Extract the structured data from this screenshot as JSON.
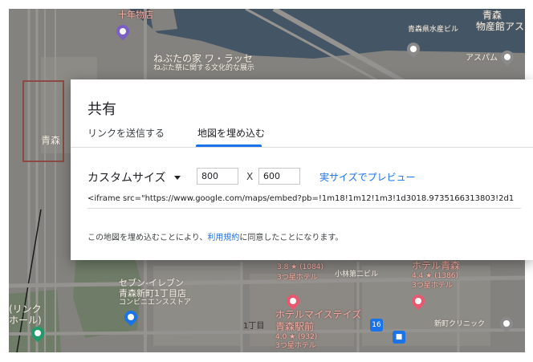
{
  "dialog": {
    "title": "共有",
    "tabs": [
      {
        "label": "リンクを送信する"
      },
      {
        "label": "地図を埋め込む"
      }
    ],
    "size_label": "カスタムサイズ",
    "width_value": "800",
    "height_value": "600",
    "x_separator": "X",
    "preview_link": "実サイズでプレビュー",
    "embed_code": "<iframe src=\"https://www.google.com/maps/embed?pb=!1m18!1m12!1m3!1d3018.9735166313803!2d1",
    "agreement_prefix": "この地図を埋め込むことにより、",
    "agreement_link": "利用規約",
    "agreement_suffix": "に同意したことになります。"
  },
  "map": {
    "labels": {
      "top_left": "十年物店",
      "nebuta_1": "ねぶたの家 ワ・ラッセ",
      "nebuta_2": "ねぶた祭に関する文化的な展示",
      "suisan": "青森県水産ビル",
      "bussan_1": "青森",
      "bussan_2": "物産館アス",
      "aspam": "アスパム",
      "aomori_sta": "青森",
      "link_1": "(リンク",
      "link_2": "ホール)",
      "seven_1": "セブン-イレブン",
      "seven_2": "青森新町1丁目店",
      "seven_3": "コンビニエンスストア",
      "rating_a": "3.8 ★ (1084)",
      "hotel_a": "3つ星ホテル",
      "komatsu": "小林第二ビル",
      "hotel_b": "ホテル青森",
      "rating_b": "4.4 ★ (1386)",
      "hotel_b_star": "3つ星ホテル",
      "hotel_c_1": "ホテルマイステイズ",
      "hotel_c_2": "青森駅前",
      "rating_c": "4.0 ★ (932)",
      "hotel_c_star": "3つ星ホテル",
      "chome": "1丁目",
      "clinic": "新町クリニック",
      "route": "16"
    }
  }
}
